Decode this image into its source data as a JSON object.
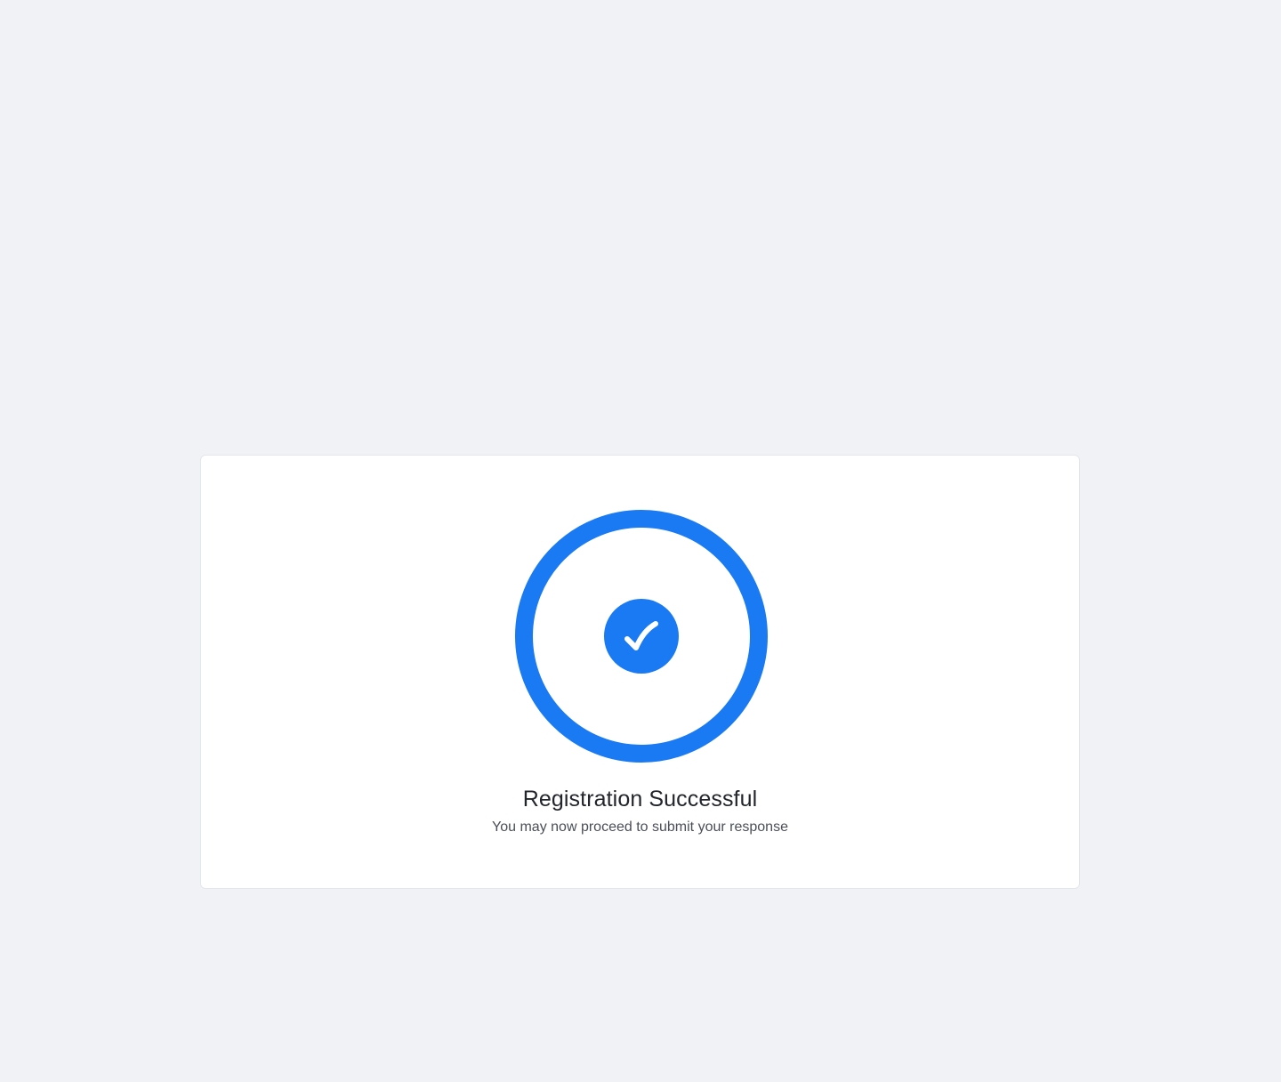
{
  "colors": {
    "background": "#f0f2f6",
    "card": "#ffffff",
    "accent": "#1a7af3",
    "title_text": "#22252b",
    "subtitle_text": "#4a4f59"
  },
  "success": {
    "icon": "checkmark-icon",
    "title": "Registration Successful",
    "message": "You may now proceed to submit your response"
  }
}
